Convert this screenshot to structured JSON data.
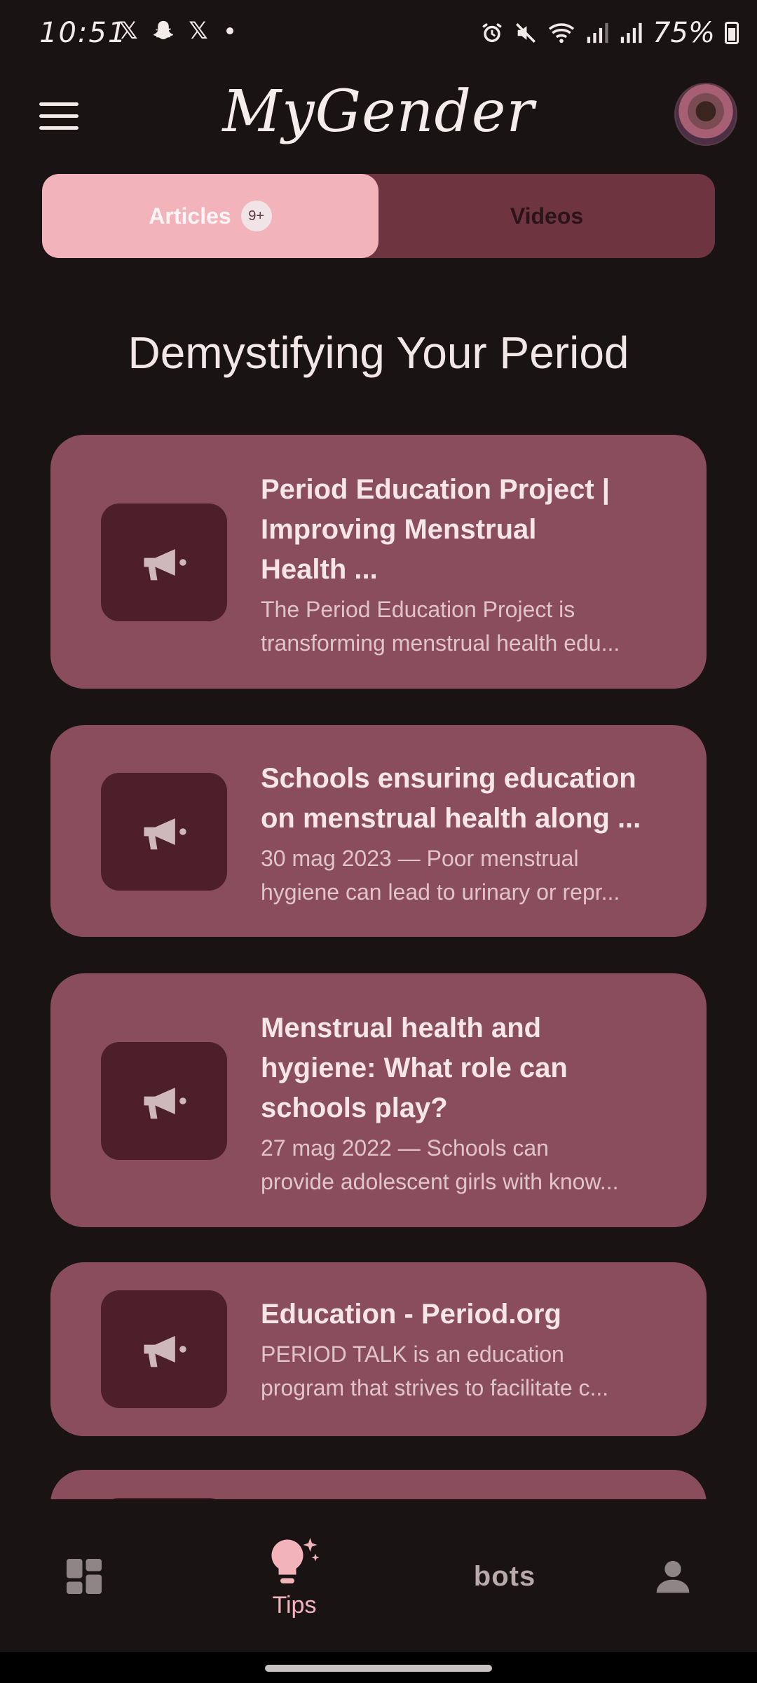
{
  "status_bar": {
    "time": "10:51",
    "battery": "75%"
  },
  "app": {
    "title": "MyGender"
  },
  "tabs": [
    {
      "label": "Articles",
      "badge": "9+"
    },
    {
      "label": "Videos"
    }
  ],
  "section_title": "Demystifying Your Period",
  "articles": [
    {
      "title_lines": [
        "Period Education Project |",
        "Improving Menstrual",
        "Health ..."
      ],
      "desc_lines": [
        "The Period Education Project is",
        "transforming menstrual health edu..."
      ]
    },
    {
      "title_lines": [
        "Schools ensuring education",
        "on menstrual health along ..."
      ],
      "desc_lines": [
        "30 mag 2023 — Poor menstrual",
        "hygiene can lead to urinary or repr..."
      ]
    },
    {
      "title_lines": [
        "Menstrual health and",
        "hygiene: What role can",
        "schools play?"
      ],
      "desc_lines": [
        "27 mag 2022 — Schools can",
        "provide adolescent girls with know..."
      ]
    },
    {
      "title_lines": [
        "Education - Period.org"
      ],
      "desc_lines": [
        "PERIOD TALK is an education",
        "program that strives to facilitate c..."
      ]
    }
  ],
  "bottom_nav": {
    "tips_label": "Tips",
    "bots_label": "bots"
  },
  "icons": {
    "card": "megaphone-icon",
    "nav": [
      "dashboard-icon",
      "lightbulb-sparkle-icon",
      "bots-logo",
      "person-icon"
    ]
  },
  "colors": {
    "accent": "#f3b3bb",
    "card": "#8a4d5b",
    "card_icon_bg": "#4c1f29",
    "tab_track": "#6e3540"
  }
}
